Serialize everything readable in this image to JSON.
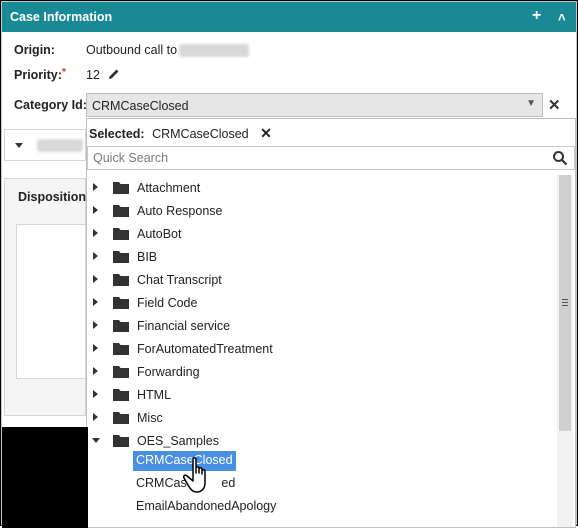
{
  "header": {
    "title": "Case Information",
    "add_symbol": "+",
    "collapse_symbol": "˄"
  },
  "fields": {
    "origin_label": "Origin:",
    "origin_value": "Outbound call to",
    "priority_label": "Priority:",
    "priority_required": "*",
    "priority_value": "12",
    "category_label": "Category Id:",
    "category_value": "CRMCaseClosed"
  },
  "clear_symbol": "✕",
  "left_panel": {
    "disposition_label": "Disposition"
  },
  "dropdown": {
    "selected_label": "Selected:",
    "selected_value": "CRMCaseClosed",
    "search_placeholder": "Quick Search",
    "folders": [
      {
        "label": "Attachment",
        "expanded": false
      },
      {
        "label": "Auto Response",
        "expanded": false
      },
      {
        "label": "AutoBot",
        "expanded": false
      },
      {
        "label": "BIB",
        "expanded": false
      },
      {
        "label": "Chat Transcript",
        "expanded": false
      },
      {
        "label": "Field Code",
        "expanded": false
      },
      {
        "label": "Financial service",
        "expanded": false
      },
      {
        "label": "ForAutomatedTreatment",
        "expanded": false
      },
      {
        "label": "Forwarding",
        "expanded": false
      },
      {
        "label": "HTML",
        "expanded": false
      },
      {
        "label": "Misc",
        "expanded": false
      },
      {
        "label": "OES_Samples",
        "expanded": true
      }
    ],
    "children": [
      {
        "label": "CRMCaseClosed",
        "selected": true
      },
      {
        "label": "CRMCase        ed",
        "selected": false
      },
      {
        "label": "EmailAbandonedApology",
        "selected": false
      }
    ]
  },
  "colors": {
    "header_bg": "#1a8996",
    "selection_bg": "#4a90e2"
  }
}
